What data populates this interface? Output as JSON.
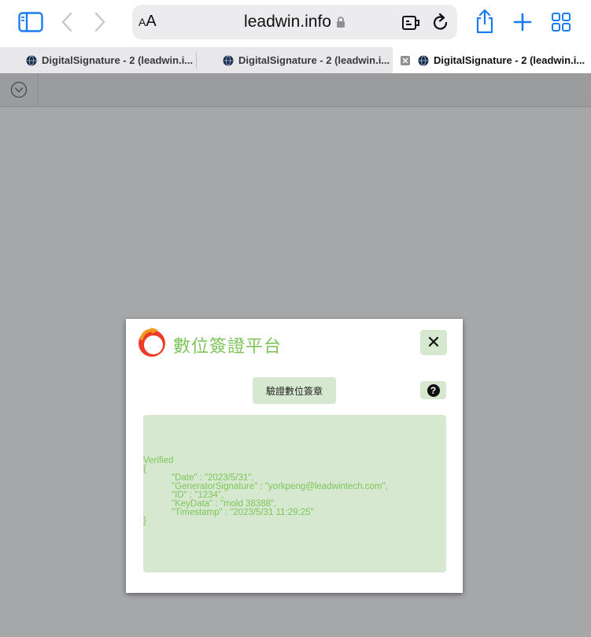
{
  "browser": {
    "aa_label_big": "A",
    "aa_label_small": "A",
    "url": "leadwin.info",
    "tabs": [
      {
        "label": "DigitalSignature - 2 (leadwin.i..."
      },
      {
        "label": "DigitalSignature - 2 (leadwin.i..."
      },
      {
        "label": "DigitalSignature - 2 (leadwin.i..."
      }
    ]
  },
  "modal": {
    "title": "數位簽證平台",
    "close_label": "✕",
    "verify_button_label": "驗證數位簽章",
    "help_label": "?",
    "result": {
      "status": "Verified",
      "open_brace": "{",
      "lines": [
        "\"Date\" : \"2023/5/31\",",
        "\"GeneratorSignature\" : \"yorkpeng@leadwintech.com\",",
        "\"ID\" : \"1234\",",
        "\"KeyData\" : \"mold 38388\",",
        "\"Timestamp\" : \"2023/5/31 11:29:25\""
      ],
      "close_brace": "}"
    }
  },
  "colors": {
    "accent_green": "#7dc55a",
    "panel_green": "#d6e8cf",
    "ios_blue": "#1a7cf5",
    "backdrop": "#a6a7a9"
  }
}
